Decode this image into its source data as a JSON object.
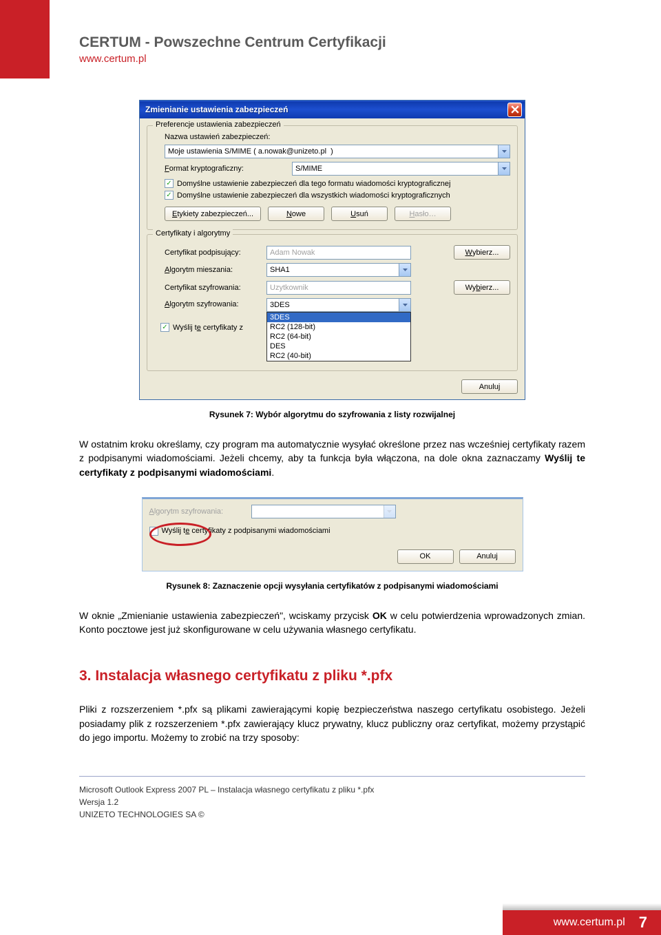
{
  "header": {
    "title": "CERTUM - Powszechne Centrum Certyfikacji",
    "url": "www.certum.pl"
  },
  "dialog1": {
    "title": "Zmienianie ustawienia zabezpieczeń",
    "group1": {
      "legend": "Preferencje ustawienia zabezpieczeń",
      "name_label": "Nazwa ustawień zabezpieczeń:",
      "name_value": "Moje ustawienia S/MIME ( a.nowak@unizeto.pl  )",
      "format_label_pre": "F",
      "format_label_post": "ormat kryptograficzny:",
      "format_value": "S/MIME",
      "check1": "Domyślne ustawienie zabezpieczeń dla tego formatu wiadomości kryptograficznej",
      "check2": "Domyślne ustawienie zabezpieczeń dla wszystkich wiadomości kryptograficznych",
      "btn_labels_pre": "E",
      "btn_labels_post": "tykiety zabezpieczeń...",
      "btn_new_pre": "N",
      "btn_new_post": "owe",
      "btn_del_pre": "U",
      "btn_del_post": "suń",
      "btn_pass_pre": "H",
      "btn_pass_post": "asło…"
    },
    "group2": {
      "legend": "Certyfikaty i algorytmy",
      "signcert_label": "Certyfikat podpisujący:",
      "signcert_value": "Adam Nowak",
      "choose1_pre": "W",
      "choose1_post": "ybierz...",
      "hashalg_label_pre": "A",
      "hashalg_label_post": "lgorytm mieszania:",
      "hashalg_value": "SHA1",
      "enccert_label": "Certyfikat szyfrowania:",
      "enccert_value": "Uzytkownik",
      "choose2_pre": "Wy",
      "choose2_ul": "b",
      "choose2_post": "ierz...",
      "encalg_label_pre": "A",
      "encalg_label_post": "lgorytm szyfrowania:",
      "encalg_value": "3DES",
      "sendcert_pre": "Wyślij t",
      "sendcert_ul": "e",
      "sendcert_post": " certyfikaty z",
      "options": {
        "o1": "3DES",
        "o2": "RC2 (128-bit)",
        "o3": "RC2 (64-bit)",
        "o4": "DES",
        "o5": "RC2 (40-bit)"
      }
    },
    "cancel": "Anuluj"
  },
  "caption7": "Rysunek 7: Wybór algorytmu do szyfrowania z listy rozwijalnej",
  "para1a": "W ostatnim kroku określamy, czy program ma automatycznie wysyłać określone przez nas wcześniej certyfikaty razem z podpisanymi wiadomościami. Jeżeli chcemy, aby ta funkcja była włączona, na dole okna zaznaczamy ",
  "para1b": "Wyślij te certyfikaty z podpisanymi wiadomościami",
  "para1c": ".",
  "dialog2": {
    "alglabel_pre": "A",
    "alglabel_post": "lgorytm szyfrowania:",
    "chk_pre": "Wyślij t",
    "chk_ul": "e",
    "chk_post": " certyfikaty z podpisanymi wiadomościami",
    "ok": "OK",
    "cancel": "Anuluj"
  },
  "caption8": "Rysunek 8: Zaznaczenie opcji wysyłania certyfikatów z podpisanymi wiadomościami",
  "para2a": "W oknie „Zmienianie ustawienia zabezpieczeń\", wciskamy przycisk ",
  "para2b": "OK",
  "para2c": " w celu potwierdzenia wprowadzonych zmian. Konto pocztowe jest już skonfigurowane w celu używania własnego certyfikatu.",
  "section3": "3.  Instalacja własnego certyfikatu  z pliku *.pfx",
  "para3": "Pliki z rozszerzeniem *.pfx są plikami zawierającymi kopię bezpieczeństwa naszego certyfikatu osobistego. Jeżeli posiadamy plik z rozszerzeniem *.pfx zawierający klucz prywatny, klucz publiczny oraz certyfikat, możemy przystąpić do jego importu. Możemy to zrobić na trzy sposoby:",
  "footer": {
    "line1": "Microsoft Outlook Express 2007 PL – Instalacja własnego certyfikatu  z pliku *.pfx",
    "line2": "Wersja 1.2",
    "line3": "UNIZETO TECHNOLOGIES SA ©"
  },
  "pagefoot": {
    "url": "www.certum.pl",
    "num": "7"
  }
}
